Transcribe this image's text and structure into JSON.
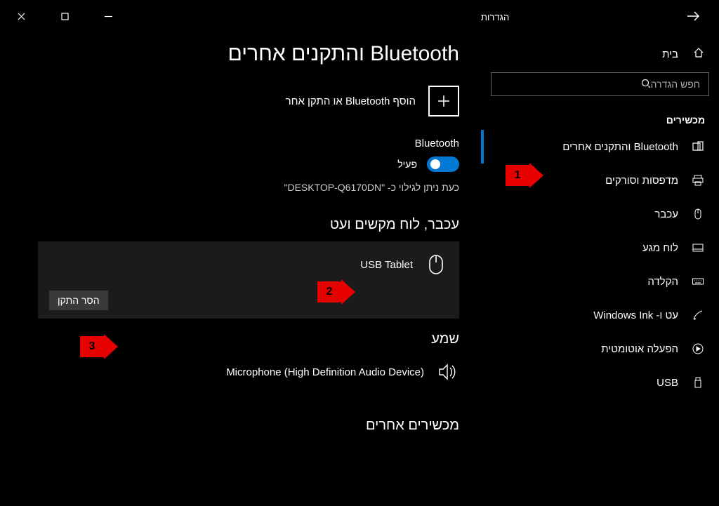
{
  "window": {
    "title": "הגדרות",
    "close": "✕",
    "max": "▢",
    "min": "—"
  },
  "sidebar": {
    "home": "בית",
    "search_placeholder": "חפש הגדרה",
    "section": "מכשירים",
    "items": [
      {
        "label": "Bluetooth והתקנים אחרים",
        "icon": "bt-devices-icon"
      },
      {
        "label": "מדפסות וסורקים",
        "icon": "printer-icon"
      },
      {
        "label": "עכבר",
        "icon": "mouse-icon"
      },
      {
        "label": "לוח מגע",
        "icon": "touchpad-icon"
      },
      {
        "label": "הקלדה",
        "icon": "keyboard-icon"
      },
      {
        "label": "עט ו- Windows Ink",
        "icon": "pen-icon"
      },
      {
        "label": "הפעלה אוטומטית",
        "icon": "autoplay-icon"
      },
      {
        "label": "USB",
        "icon": "usb-icon"
      }
    ]
  },
  "main": {
    "title": "Bluetooth והתקנים אחרים",
    "add_label": "הוסף Bluetooth או התקן אחר",
    "bt_heading": "Bluetooth",
    "bt_state": "פעיל",
    "discoverable": "כעת ניתן לגילוי כ- \"DESKTOP-Q6170DN\"",
    "group_mouse": "עכבר, לוח מקשים ועט",
    "device_usb_tablet": "USB Tablet",
    "remove": "הסר התקן",
    "group_audio": "שמע",
    "device_mic": "Microphone (High Definition Audio Device)",
    "group_other": "מכשירים אחרים"
  },
  "callouts": {
    "c1": "1",
    "c2": "2",
    "c3": "3"
  }
}
